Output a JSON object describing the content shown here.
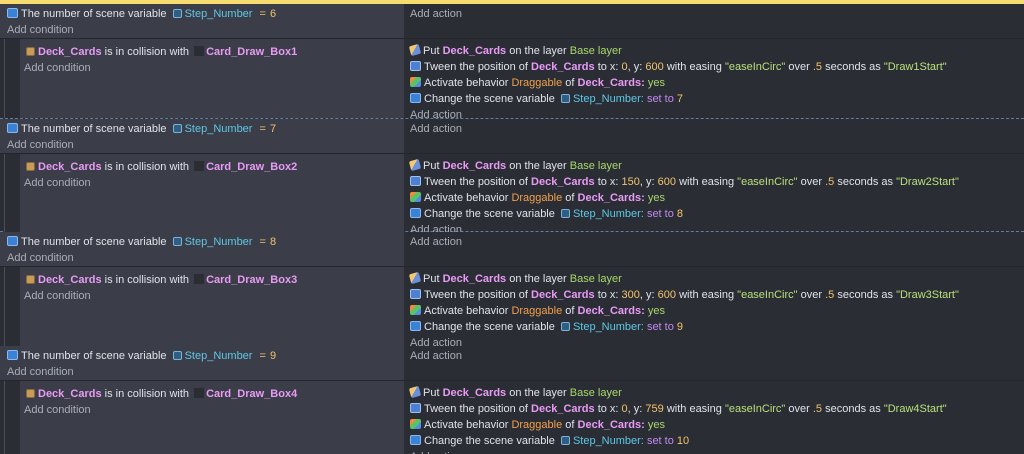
{
  "ui": {
    "add_condition": "Add condition",
    "add_action": "Add action",
    "put_word": "Put",
    "on_the_layer": "on the layer",
    "tween_word": "Tween the position of",
    "to_x": "to x:",
    "y_word": ", y:",
    "with_easing": "with easing",
    "over": "over",
    "seconds_as": "seconds as",
    "activate": "Activate behavior",
    "of_word": "of",
    "change_var": "Change the scene variable",
    "set_to": "set to",
    "the_number_of": "The number of scene variable",
    "eq": "=",
    "in_collision": "is in collision with"
  },
  "events": [
    {
      "var_name": "Step_Number",
      "value": "6",
      "object": "Deck_Cards",
      "target": "Card_Draw_Box1",
      "layer": "Base layer",
      "tween_x": "0",
      "tween_y": "600",
      "easing": "\"easeInCirc\"",
      "duration": ".5",
      "tween_name": "\"Draw1Start\"",
      "behavior": "Draggable",
      "behavior_value": "yes",
      "new_value": "7"
    },
    {
      "var_name": "Step_Number",
      "value": "7",
      "object": "Deck_Cards",
      "target": "Card_Draw_Box2",
      "layer": "Base layer",
      "tween_x": "150",
      "tween_y": "600",
      "easing": "\"easeInCirc\"",
      "duration": ".5",
      "tween_name": "\"Draw2Start\"",
      "behavior": "Draggable",
      "behavior_value": "yes",
      "new_value": "8"
    },
    {
      "var_name": "Step_Number",
      "value": "8",
      "object": "Deck_Cards",
      "target": "Card_Draw_Box3",
      "layer": "Base layer",
      "tween_x": "300",
      "tween_y": "600",
      "easing": "\"easeInCirc\"",
      "duration": ".5",
      "tween_name": "\"Draw3Start\"",
      "behavior": "Draggable",
      "behavior_value": "yes",
      "new_value": "9"
    },
    {
      "var_name": "Step_Number",
      "value": "9",
      "object": "Deck_Cards",
      "target": "Card_Draw_Box4",
      "layer": "Base layer",
      "tween_x": "0",
      "tween_y": "759",
      "easing": "\"easeInCirc\"",
      "duration": ".5",
      "tween_name": "\"Draw4Start\"",
      "behavior": "Draggable",
      "behavior_value": "yes",
      "new_value": "10"
    }
  ],
  "colors": {
    "background": "#2b2d35",
    "condition_panel": "#3b3e48",
    "object": "#e89af5",
    "variable": "#5ec8e7",
    "number": "#f2c36b",
    "string": "#b8e07a",
    "behavior": "#f0a04b",
    "operation": "#c08af0",
    "selection_bar": "#f6dc6e"
  },
  "icons": {
    "scene_variable": "scene-variable-icon",
    "variable": "variable-icon",
    "object": "deck-cards-object-icon",
    "put_layer": "pencil-layer-icon",
    "tween": "tween-icon",
    "behavior": "behavior-icon"
  }
}
